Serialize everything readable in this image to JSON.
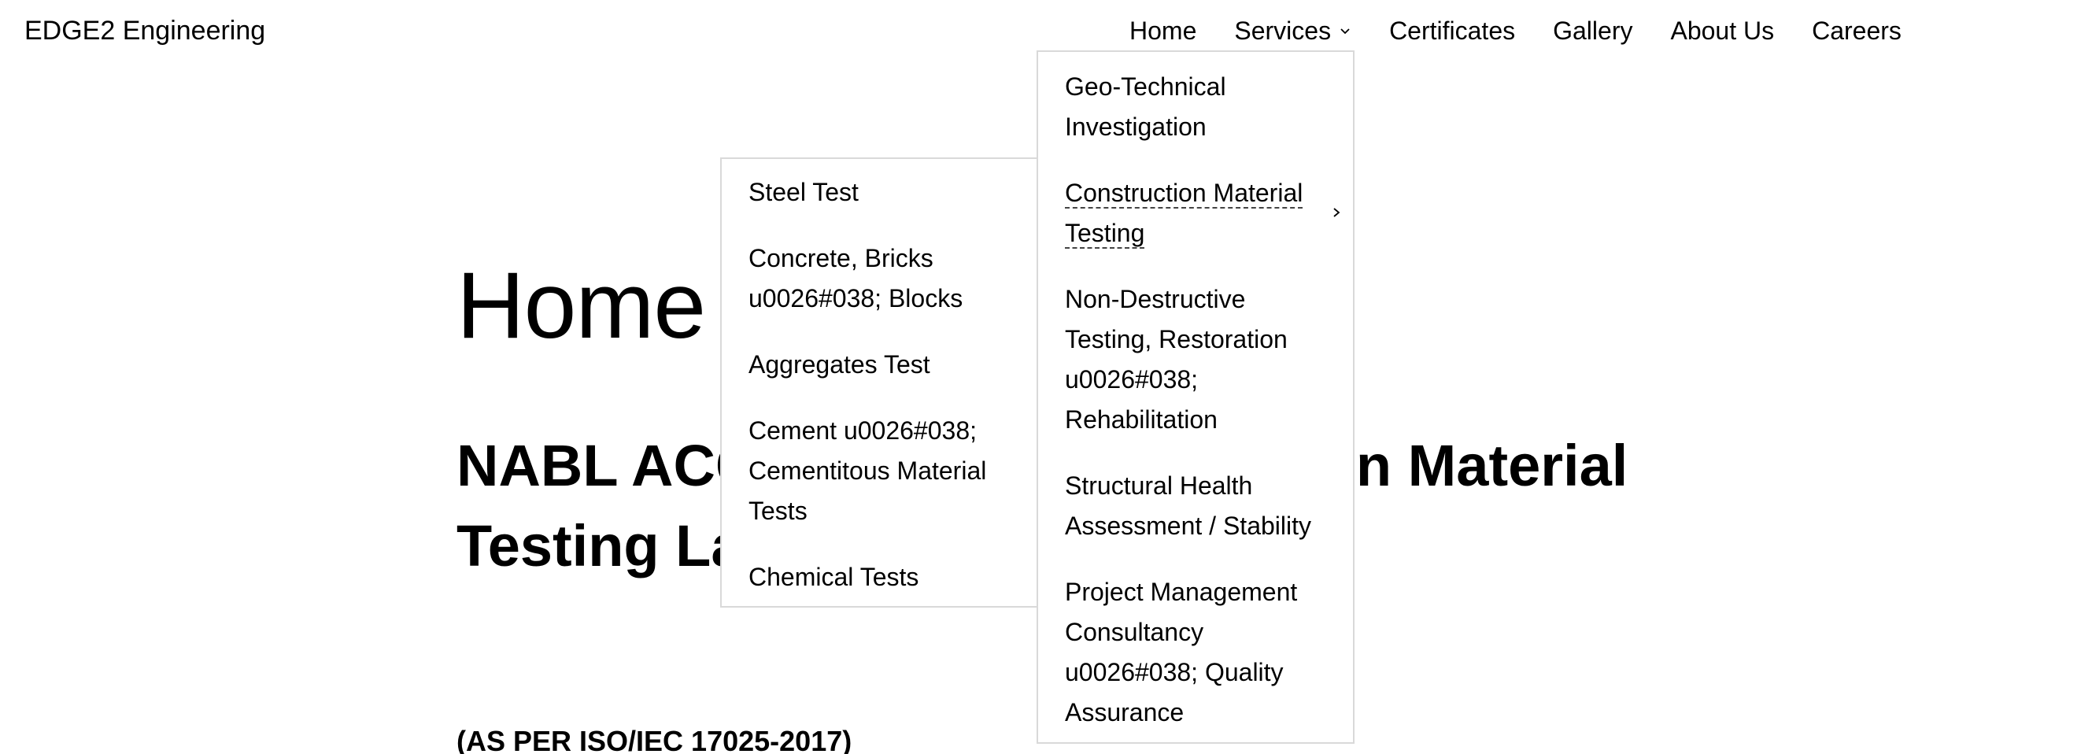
{
  "site": {
    "title": "EDGE2 Engineering"
  },
  "nav": {
    "items": [
      {
        "label": "Home"
      },
      {
        "label": "Services"
      },
      {
        "label": "Certificates"
      },
      {
        "label": "Gallery"
      },
      {
        "label": "About Us"
      },
      {
        "label": "Careers"
      }
    ]
  },
  "services_menu": {
    "items": [
      {
        "label": "Geo-Technical Investigation"
      },
      {
        "label": "Construction Material Testing"
      },
      {
        "label": "Non-Destructive Testing, Restoration u0026#038; Rehabilitation"
      },
      {
        "label": "Structural Health Assessment / Stability"
      },
      {
        "label": "Project Management Consultancy u0026#038; Quality Assurance"
      }
    ]
  },
  "materials_menu": {
    "items": [
      {
        "label": "Steel Test"
      },
      {
        "label": "Concrete, Bricks u0026#038; Blocks"
      },
      {
        "label": "Aggregates Test"
      },
      {
        "label": "Cement u0026#038; Cementitous Material Tests"
      },
      {
        "label": "Chemical Tests"
      }
    ]
  },
  "main": {
    "heading": "Home",
    "subheading": "NABL ACCREDITED Construction Material Testing Laboratory",
    "iso_note": "(AS PER ISO/IEC 17025-2017)"
  },
  "icons": {
    "dropdown": "chevron-down-icon",
    "submenu": "chevron-right-icon"
  }
}
